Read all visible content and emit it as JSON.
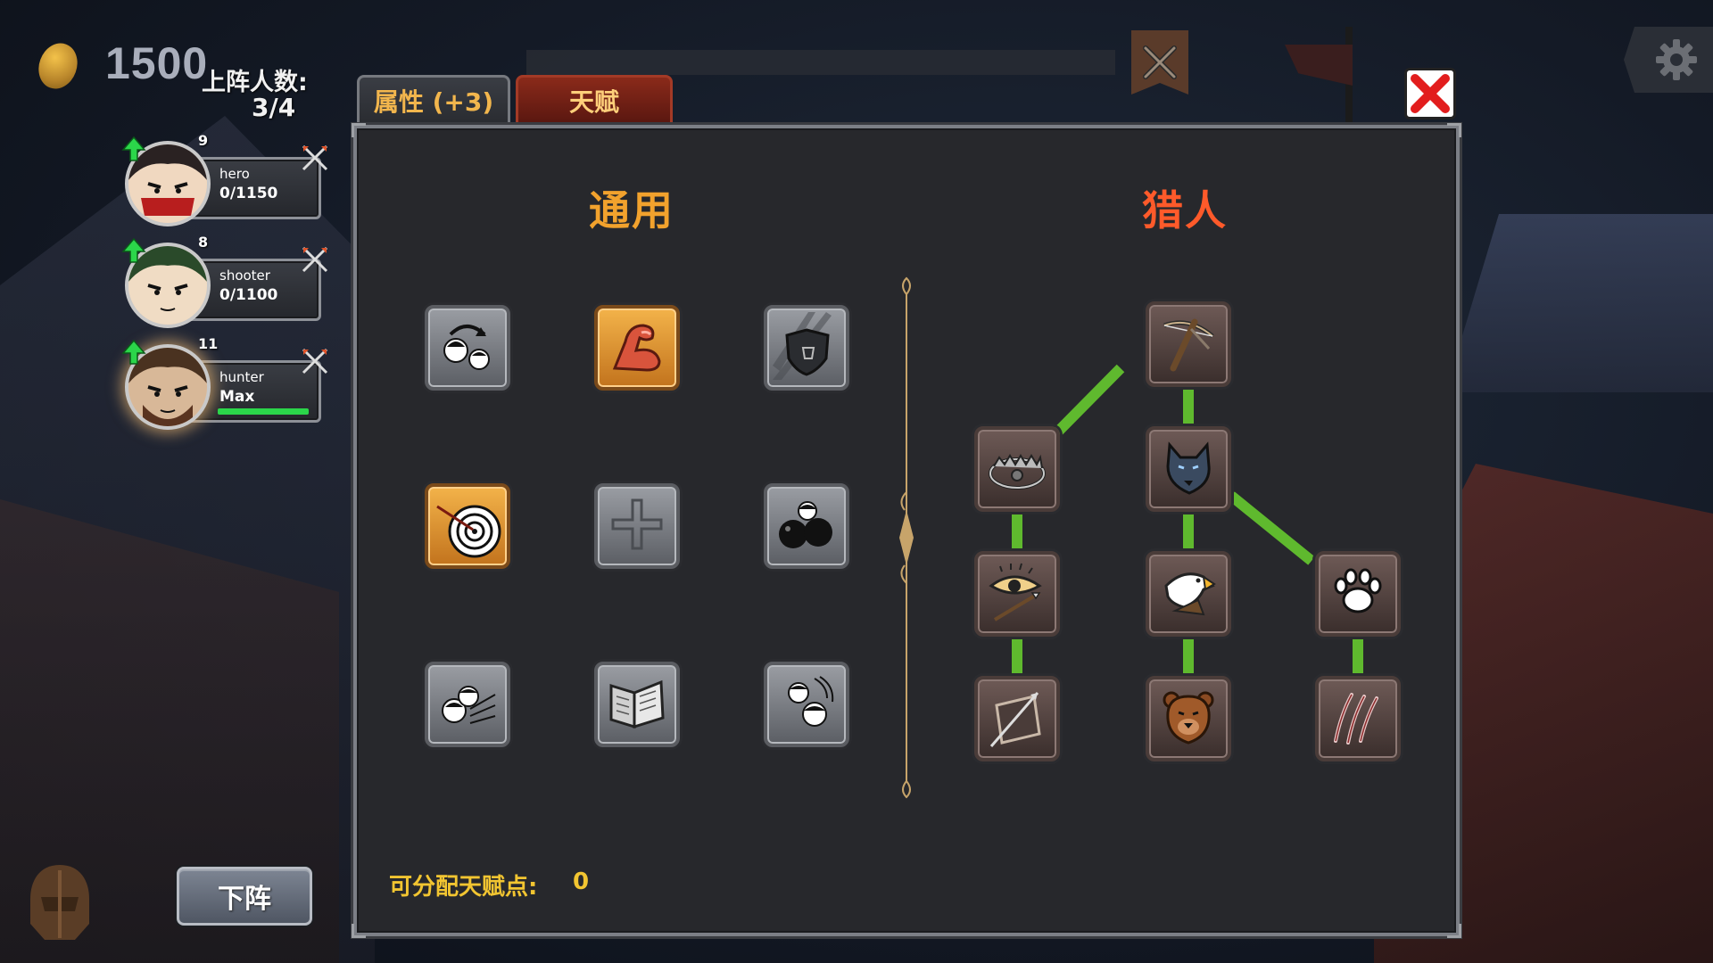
{
  "hud": {
    "coins": "1500",
    "lineup_label": "上阵人数:",
    "lineup_count": "3/4"
  },
  "heroes": [
    {
      "name": "hero",
      "level": "9",
      "exp": "0/1150",
      "exp_fraction": 0,
      "active": false
    },
    {
      "name": "shooter",
      "level": "8",
      "exp": "0/1100",
      "exp_fraction": 0,
      "active": false
    },
    {
      "name": "hunter",
      "level": "11",
      "exp": "Max",
      "exp_fraction": 1,
      "active": true
    }
  ],
  "tabs": {
    "attributes": "属性 (+3)",
    "talent": "天赋",
    "selected": "talent"
  },
  "panel": {
    "general_title": "通用",
    "class_title": "猎人",
    "points_label": "可分配天赋点:",
    "points_value": "0"
  },
  "general_talents": [
    {
      "icon": "swap-heroes-icon",
      "state": "locked"
    },
    {
      "icon": "strength-arm-icon",
      "state": "unlocked"
    },
    {
      "icon": "shield-icon",
      "state": "locked"
    },
    {
      "icon": "target-icon",
      "state": "unlocked"
    },
    {
      "icon": "plus-icon",
      "state": "locked"
    },
    {
      "icon": "heavy-balls-icon",
      "state": "locked"
    },
    {
      "icon": "arrow-volley-icon",
      "state": "locked"
    },
    {
      "icon": "book-icon",
      "state": "locked"
    },
    {
      "icon": "dodge-icon",
      "state": "locked"
    }
  ],
  "hunter_talents": [
    {
      "icon": "crossbow-icon"
    },
    {
      "icon": "bear-trap-icon"
    },
    {
      "icon": "wolf-icon"
    },
    {
      "icon": "eagle-eye-arrow-icon"
    },
    {
      "icon": "eagle-icon"
    },
    {
      "icon": "paw-icon"
    },
    {
      "icon": "quiver-icon"
    },
    {
      "icon": "bear-icon"
    },
    {
      "icon": "claw-icon"
    }
  ],
  "buttons": {
    "remove": "下阵"
  },
  "colors": {
    "gold_title": "#f2a22d",
    "hunter_title": "#ff5a2a",
    "link_green": "#5fb92e",
    "points_yellow": "#f2c531"
  }
}
